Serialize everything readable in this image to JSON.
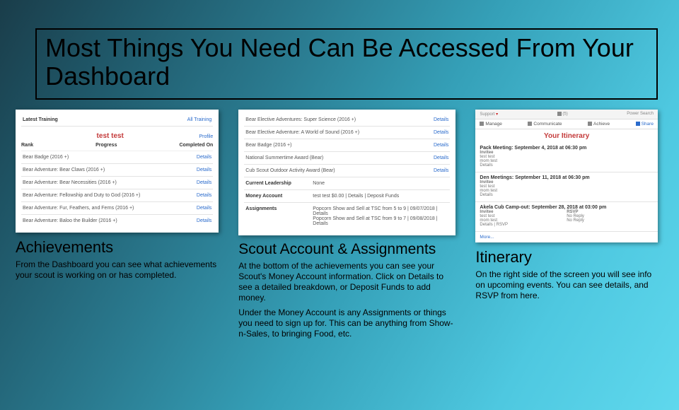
{
  "title": "Most Things You Need Can Be Accessed From Your Dashboard",
  "achievements": {
    "caption_title": "Achievements",
    "caption_body": "From the Dashboard you can see what achievements your scout is working on or has completed.",
    "latest_training": "Latest Training",
    "all_training": "All Training",
    "scout_name": "test test",
    "profile": "Profile",
    "col_rank": "Rank",
    "col_progress": "Progress",
    "col_completed": "Completed On",
    "details": "Details",
    "rows": [
      "Bear Badge (2016 +)",
      "Bear Adventure: Bear Claws (2016 +)",
      "Bear Adventure: Bear Necessities (2016 +)",
      "Bear Adventure: Fellowship and Duty to God (2016 +)",
      "Bear Adventure: Fur, Feathers, and Ferns (2016 +)",
      "Bear Adventure: Baloo the Builder (2016 +)"
    ]
  },
  "scout_account": {
    "caption_title": "Scout Account & Assignments",
    "caption_p1": "At the bottom of the achievements you can see your Scout's Money Account information. Click on Details to see a detailed breakdown, or Deposit Funds to add money.",
    "caption_p2": "Under the Money Account is any Assignments or things you need to sign up for. This can be anything from Show-n-Sales, to bringing Food, etc.",
    "details": "Details",
    "rows": [
      "Bear Elective Adventures: Super Science (2016 +)",
      "Bear Elective Adventure: A World of Sound (2016 +)",
      "Bear Badge (2016 +)",
      "National Summertime Award (Bear)",
      "Cub Scout Outdoor Activity Award (Bear)"
    ],
    "leadership_label": "Current Leadership",
    "leadership_value": "None",
    "money_label": "Money Account",
    "money_value": "test test $0.00 | Details | Deposit Funds",
    "assign_label": "Assignments",
    "assign1": "Popcorn Show and Sell at TSC from 5 to 9 | 09/07/2018 | Details",
    "assign2": "Popcorn Show and Sell at TSC from 9 to 7 | 09/08/2018 | Details"
  },
  "itinerary": {
    "caption_title": "Itinerary",
    "caption_body": "On the right side of the screen you will see info on upcoming events. You can see details, and RSVP from here.",
    "support": "Support",
    "count": "(5)",
    "power_search": "Power Search",
    "tab_manage": "Manage",
    "tab_comm": "Communicate",
    "tab_achieve": "Achieve",
    "tab_share": "Share",
    "panel_title": "Your Itinerary",
    "e1_title": "Pack Meeting: September 4, 2018 at 06:30 pm",
    "e2_title": "Den Meetings: September 11, 2018 at 06:30 pm",
    "e3_title": "Akela Cub Camp-out: September 28, 2018 at 03:00 pm",
    "invitee": "Invitee",
    "rsvp": "RSVP",
    "test": "test test",
    "mom": "mom test",
    "noreply": "No Reply",
    "details_link": "Details",
    "details_rsvp": "Details | RSVP",
    "more": "More..."
  }
}
